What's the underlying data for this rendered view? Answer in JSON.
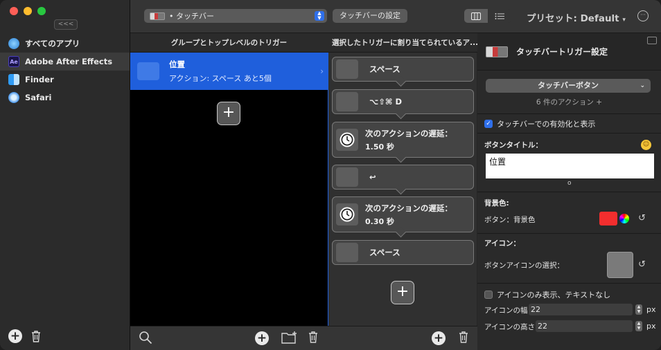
{
  "sidebar": {
    "collapse_label": "<<<",
    "apps": [
      {
        "label": "すべてのアプリ",
        "icon": "all-apps-icon"
      },
      {
        "label": "Adobe After Effects",
        "icon": "after-effects-icon",
        "icon_text": "Ae"
      },
      {
        "label": "Finder",
        "icon": "finder-icon"
      },
      {
        "label": "Safari",
        "icon": "safari-icon"
      }
    ]
  },
  "toolbar": {
    "touchbar_select": "タッチバー",
    "touchbar_settings": "タッチバーの設定",
    "preset": "プリセット: Default",
    "preset_chevron": "▾",
    "more": "···"
  },
  "triggers": {
    "header": "グループとトップレベルのトリガー",
    "items": [
      {
        "title": "位置",
        "subtitle": "アクション: スペース あと5個"
      }
    ]
  },
  "actions": {
    "header": "選択したトリガーに割り当てられているア...",
    "items": [
      {
        "label": "スペース"
      },
      {
        "label": "⌥⇧⌘ D"
      },
      {
        "label": "次のアクションの遅延：",
        "value": "1.50 秒"
      },
      {
        "label": "↩"
      },
      {
        "label": "次のアクションの遅延：",
        "value": "0.30 秒"
      },
      {
        "label": "スペース"
      }
    ]
  },
  "panel": {
    "title": "タッチバートリガー設定",
    "type_select": "タッチバーボタン",
    "type_chevron": "⌄",
    "action_count": "6 件のアクション +",
    "enable_label": "タッチバーでの有効化と表示",
    "button_title_label": "ボタンタイトル：",
    "button_title_value": "位置",
    "title_dot": "o",
    "bg_color_label": "背景色:",
    "bg_color_sub": "ボタン：背景色",
    "bg_color": "#f32e2e",
    "icon_label": "アイコン：",
    "icon_select_label": "ボタンアイコンの選択：",
    "icon_only_label": "アイコンのみ表示、テキストなし",
    "icon_width_label": "アイコンの幅",
    "icon_width_value": "22",
    "icon_height_label": "アイコンの高さ",
    "icon_height_value": "22",
    "unit": "px"
  },
  "colors": {
    "accent": "#2f6fea",
    "selected_row": "#1f5fdc"
  }
}
